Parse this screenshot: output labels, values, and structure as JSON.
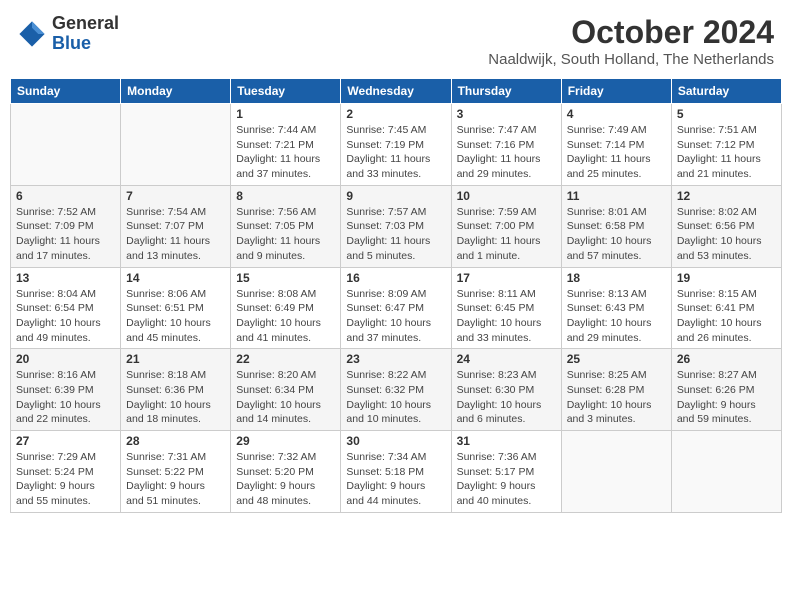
{
  "header": {
    "logo_general": "General",
    "logo_blue": "Blue",
    "month_title": "October 2024",
    "location": "Naaldwijk, South Holland, The Netherlands"
  },
  "weekdays": [
    "Sunday",
    "Monday",
    "Tuesday",
    "Wednesday",
    "Thursday",
    "Friday",
    "Saturday"
  ],
  "weeks": [
    [
      {
        "day": "",
        "content": ""
      },
      {
        "day": "",
        "content": ""
      },
      {
        "day": "1",
        "content": "Sunrise: 7:44 AM\nSunset: 7:21 PM\nDaylight: 11 hours and 37 minutes."
      },
      {
        "day": "2",
        "content": "Sunrise: 7:45 AM\nSunset: 7:19 PM\nDaylight: 11 hours and 33 minutes."
      },
      {
        "day": "3",
        "content": "Sunrise: 7:47 AM\nSunset: 7:16 PM\nDaylight: 11 hours and 29 minutes."
      },
      {
        "day": "4",
        "content": "Sunrise: 7:49 AM\nSunset: 7:14 PM\nDaylight: 11 hours and 25 minutes."
      },
      {
        "day": "5",
        "content": "Sunrise: 7:51 AM\nSunset: 7:12 PM\nDaylight: 11 hours and 21 minutes."
      }
    ],
    [
      {
        "day": "6",
        "content": "Sunrise: 7:52 AM\nSunset: 7:09 PM\nDaylight: 11 hours and 17 minutes."
      },
      {
        "day": "7",
        "content": "Sunrise: 7:54 AM\nSunset: 7:07 PM\nDaylight: 11 hours and 13 minutes."
      },
      {
        "day": "8",
        "content": "Sunrise: 7:56 AM\nSunset: 7:05 PM\nDaylight: 11 hours and 9 minutes."
      },
      {
        "day": "9",
        "content": "Sunrise: 7:57 AM\nSunset: 7:03 PM\nDaylight: 11 hours and 5 minutes."
      },
      {
        "day": "10",
        "content": "Sunrise: 7:59 AM\nSunset: 7:00 PM\nDaylight: 11 hours and 1 minute."
      },
      {
        "day": "11",
        "content": "Sunrise: 8:01 AM\nSunset: 6:58 PM\nDaylight: 10 hours and 57 minutes."
      },
      {
        "day": "12",
        "content": "Sunrise: 8:02 AM\nSunset: 6:56 PM\nDaylight: 10 hours and 53 minutes."
      }
    ],
    [
      {
        "day": "13",
        "content": "Sunrise: 8:04 AM\nSunset: 6:54 PM\nDaylight: 10 hours and 49 minutes."
      },
      {
        "day": "14",
        "content": "Sunrise: 8:06 AM\nSunset: 6:51 PM\nDaylight: 10 hours and 45 minutes."
      },
      {
        "day": "15",
        "content": "Sunrise: 8:08 AM\nSunset: 6:49 PM\nDaylight: 10 hours and 41 minutes."
      },
      {
        "day": "16",
        "content": "Sunrise: 8:09 AM\nSunset: 6:47 PM\nDaylight: 10 hours and 37 minutes."
      },
      {
        "day": "17",
        "content": "Sunrise: 8:11 AM\nSunset: 6:45 PM\nDaylight: 10 hours and 33 minutes."
      },
      {
        "day": "18",
        "content": "Sunrise: 8:13 AM\nSunset: 6:43 PM\nDaylight: 10 hours and 29 minutes."
      },
      {
        "day": "19",
        "content": "Sunrise: 8:15 AM\nSunset: 6:41 PM\nDaylight: 10 hours and 26 minutes."
      }
    ],
    [
      {
        "day": "20",
        "content": "Sunrise: 8:16 AM\nSunset: 6:39 PM\nDaylight: 10 hours and 22 minutes."
      },
      {
        "day": "21",
        "content": "Sunrise: 8:18 AM\nSunset: 6:36 PM\nDaylight: 10 hours and 18 minutes."
      },
      {
        "day": "22",
        "content": "Sunrise: 8:20 AM\nSunset: 6:34 PM\nDaylight: 10 hours and 14 minutes."
      },
      {
        "day": "23",
        "content": "Sunrise: 8:22 AM\nSunset: 6:32 PM\nDaylight: 10 hours and 10 minutes."
      },
      {
        "day": "24",
        "content": "Sunrise: 8:23 AM\nSunset: 6:30 PM\nDaylight: 10 hours and 6 minutes."
      },
      {
        "day": "25",
        "content": "Sunrise: 8:25 AM\nSunset: 6:28 PM\nDaylight: 10 hours and 3 minutes."
      },
      {
        "day": "26",
        "content": "Sunrise: 8:27 AM\nSunset: 6:26 PM\nDaylight: 9 hours and 59 minutes."
      }
    ],
    [
      {
        "day": "27",
        "content": "Sunrise: 7:29 AM\nSunset: 5:24 PM\nDaylight: 9 hours and 55 minutes."
      },
      {
        "day": "28",
        "content": "Sunrise: 7:31 AM\nSunset: 5:22 PM\nDaylight: 9 hours and 51 minutes."
      },
      {
        "day": "29",
        "content": "Sunrise: 7:32 AM\nSunset: 5:20 PM\nDaylight: 9 hours and 48 minutes."
      },
      {
        "day": "30",
        "content": "Sunrise: 7:34 AM\nSunset: 5:18 PM\nDaylight: 9 hours and 44 minutes."
      },
      {
        "day": "31",
        "content": "Sunrise: 7:36 AM\nSunset: 5:17 PM\nDaylight: 9 hours and 40 minutes."
      },
      {
        "day": "",
        "content": ""
      },
      {
        "day": "",
        "content": ""
      }
    ]
  ]
}
